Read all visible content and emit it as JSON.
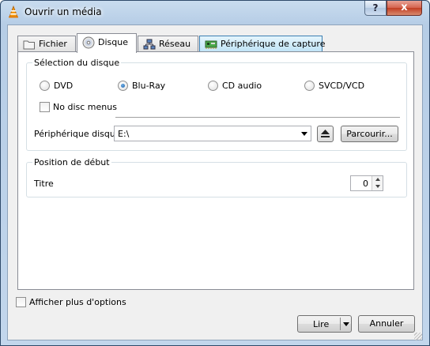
{
  "window": {
    "title": "Ouvrir un média",
    "help_label": "?",
    "close_label": "x"
  },
  "tabs": [
    {
      "label": "Fichier",
      "icon": "folder-icon"
    },
    {
      "label": "Disque",
      "icon": "disc-icon"
    },
    {
      "label": "Réseau",
      "icon": "network-icon"
    },
    {
      "label": "Périphérique de capture",
      "icon": "capture-card-icon"
    }
  ],
  "active_tab": "Disque",
  "disc_selection": {
    "title": "Sélection du disque",
    "options": [
      "DVD",
      "Blu-Ray",
      "CD audio",
      "SVCD/VCD"
    ],
    "selected": "Blu-Ray",
    "no_menus_label": "No disc menus",
    "no_menus_checked": false,
    "device_label": "Périphérique disque",
    "device_value": "E:\\",
    "browse_label": "Parcourir..."
  },
  "start_position": {
    "title": "Position de début",
    "title_label": "Titre",
    "title_value": "0"
  },
  "footer": {
    "more_options_label": "Afficher plus d'options",
    "more_options_checked": false,
    "play_label": "Lire",
    "cancel_label": "Annuler"
  },
  "colors": {
    "accent_radio": "#1b5da6",
    "titlebar": "#c2d6ec",
    "close_button": "#c23d22"
  }
}
